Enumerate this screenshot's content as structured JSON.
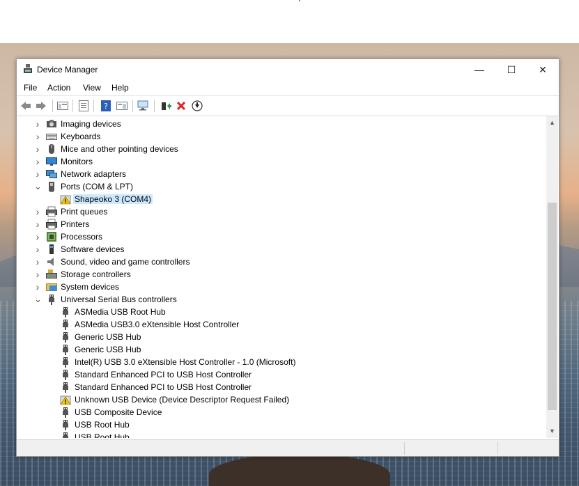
{
  "window": {
    "title": "Device Manager",
    "controls": {
      "minimize": "—",
      "maximize": "☐",
      "close": "✕"
    }
  },
  "menu": [
    "File",
    "Action",
    "View",
    "Help"
  ],
  "toolbar": {
    "buttons": [
      "back-icon",
      "forward-icon",
      "show-hide-console-tree-icon",
      "properties-icon",
      "help-icon",
      "action-pane-icon",
      "scan-hardware-icon",
      "update-driver-icon",
      "uninstall-icon",
      "disable-device-icon"
    ]
  },
  "tree": {
    "items": [
      {
        "label": "Imaging devices",
        "level": 0,
        "expander": "collapsed",
        "icon": "camera-icon"
      },
      {
        "label": "Keyboards",
        "level": 0,
        "expander": "collapsed",
        "icon": "keyboard-icon"
      },
      {
        "label": "Mice and other pointing devices",
        "level": 0,
        "expander": "collapsed",
        "icon": "mouse-icon"
      },
      {
        "label": "Monitors",
        "level": 0,
        "expander": "collapsed",
        "icon": "monitor-icon"
      },
      {
        "label": "Network adapters",
        "level": 0,
        "expander": "collapsed",
        "icon": "network-icon"
      },
      {
        "label": "Ports (COM & LPT)",
        "level": 0,
        "expander": "expanded",
        "icon": "port-icon"
      },
      {
        "label": "Shapeoko 3 (COM4)",
        "level": 1,
        "expander": "none",
        "icon": "warning-device-icon",
        "selected": true
      },
      {
        "label": "Print queues",
        "level": 0,
        "expander": "collapsed",
        "icon": "printer-icon"
      },
      {
        "label": "Printers",
        "level": 0,
        "expander": "collapsed",
        "icon": "printer-icon"
      },
      {
        "label": "Processors",
        "level": 0,
        "expander": "collapsed",
        "icon": "processor-icon"
      },
      {
        "label": "Software devices",
        "level": 0,
        "expander": "collapsed",
        "icon": "software-device-icon"
      },
      {
        "label": "Sound, video and game controllers",
        "level": 0,
        "expander": "collapsed",
        "icon": "speaker-icon"
      },
      {
        "label": "Storage controllers",
        "level": 0,
        "expander": "collapsed",
        "icon": "storage-icon"
      },
      {
        "label": "System devices",
        "level": 0,
        "expander": "collapsed",
        "icon": "system-folder-icon"
      },
      {
        "label": "Universal Serial Bus controllers",
        "level": 0,
        "expander": "expanded",
        "icon": "usb-icon"
      },
      {
        "label": "ASMedia USB Root Hub",
        "level": 1,
        "expander": "none",
        "icon": "usb-icon"
      },
      {
        "label": "ASMedia USB3.0 eXtensible Host Controller",
        "level": 1,
        "expander": "none",
        "icon": "usb-icon"
      },
      {
        "label": "Generic USB Hub",
        "level": 1,
        "expander": "none",
        "icon": "usb-icon"
      },
      {
        "label": "Generic USB Hub",
        "level": 1,
        "expander": "none",
        "icon": "usb-icon"
      },
      {
        "label": "Intel(R) USB 3.0 eXtensible Host Controller - 1.0 (Microsoft)",
        "level": 1,
        "expander": "none",
        "icon": "usb-icon"
      },
      {
        "label": "Standard Enhanced PCI to USB Host Controller",
        "level": 1,
        "expander": "none",
        "icon": "usb-icon"
      },
      {
        "label": "Standard Enhanced PCI to USB Host Controller",
        "level": 1,
        "expander": "none",
        "icon": "usb-icon"
      },
      {
        "label": "Unknown USB Device (Device Descriptor Request Failed)",
        "level": 1,
        "expander": "none",
        "icon": "warning-device-icon"
      },
      {
        "label": "USB Composite Device",
        "level": 1,
        "expander": "none",
        "icon": "usb-icon"
      },
      {
        "label": "USB Root Hub",
        "level": 1,
        "expander": "none",
        "icon": "usb-icon"
      },
      {
        "label": "USB Root Hub",
        "level": 1,
        "expander": "none",
        "icon": "usb-icon"
      }
    ]
  },
  "scrollbar": {
    "up": "▲",
    "down": "▼"
  },
  "colors": {
    "selection": "#cce8ff",
    "warning": "#f5c400",
    "uninstall_red": "#e0201a"
  }
}
